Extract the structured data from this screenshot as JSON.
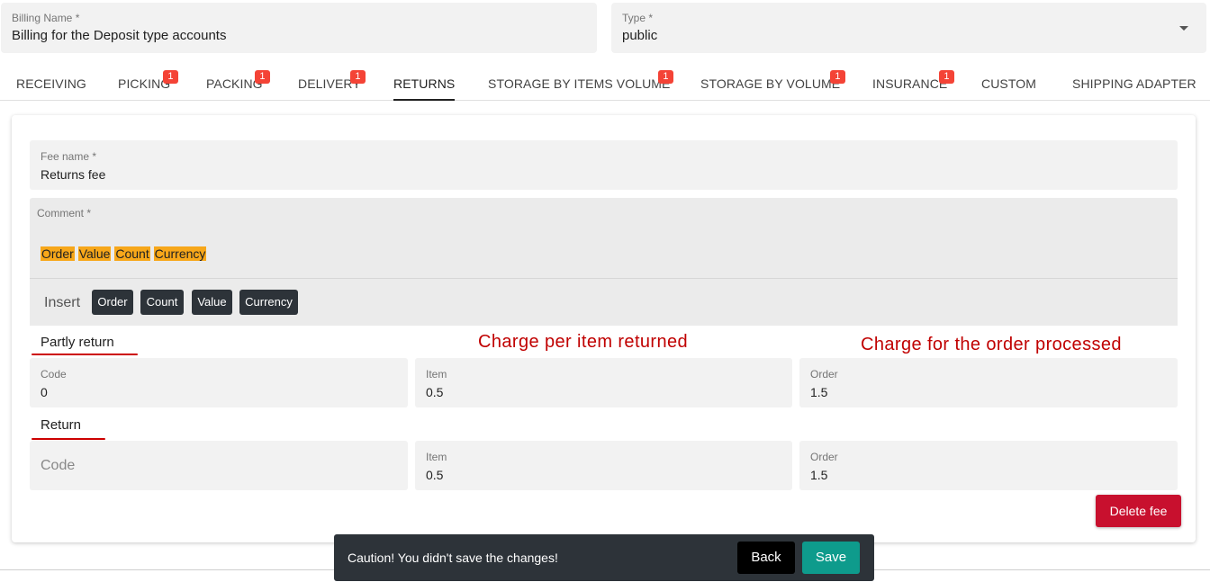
{
  "billing_name": {
    "label": "Billing Name *",
    "value": "Billing for the Deposit type accounts"
  },
  "type_select": {
    "label": "Type *",
    "value": "public",
    "icon": "chevron-down-icon"
  },
  "tabs": [
    {
      "label": "RECEIVING",
      "badge": ""
    },
    {
      "label": "PICKING",
      "badge": "1"
    },
    {
      "label": "PACKING",
      "badge": "1"
    },
    {
      "label": "DELIVERY",
      "badge": "1"
    },
    {
      "label": "RETURNS",
      "badge": "",
      "active": true
    },
    {
      "label": "STORAGE BY ITEMS VOLUME",
      "badge": "1"
    },
    {
      "label": "STORAGE BY VOLUME",
      "badge": "1"
    },
    {
      "label": "INSURANCE",
      "badge": "1"
    },
    {
      "label": "CUSTOM",
      "badge": ""
    },
    {
      "label": "SHIPPING ADAPTER",
      "badge": ""
    }
  ],
  "fee": {
    "name_label": "Fee name *",
    "name_value": "Returns fee",
    "comment_label": "Comment *",
    "comment_tokens": [
      "Order",
      "Value",
      "Count",
      "Currency"
    ],
    "insert_label": "Insert",
    "insert_buttons": [
      "Order",
      "Count",
      "Value",
      "Currency"
    ]
  },
  "partly_return": {
    "title": "Partly return",
    "code_label": "Code",
    "code_value": "0",
    "item_label": "Item",
    "item_value": "0.5",
    "order_label": "Order",
    "order_value": "1.5"
  },
  "return": {
    "title": "Return",
    "code_placeholder": "Code",
    "item_label": "Item",
    "item_value": "0.5",
    "order_label": "Order",
    "order_value": "1.5"
  },
  "annotations": {
    "item_note": "Charge per item returned",
    "order_note": "Charge for the order processed",
    "color": "#c00000"
  },
  "delete_fee_label": "Delete fee",
  "snackbar": {
    "message": "Caution! You didn't save the changes!",
    "back_label": "Back",
    "save_label": "Save"
  },
  "colors": {
    "badge": "#f44336",
    "highlight": "#f7a71a",
    "chip": "#2d3339",
    "delete": "#c8102e",
    "save": "#0e9b8c"
  }
}
